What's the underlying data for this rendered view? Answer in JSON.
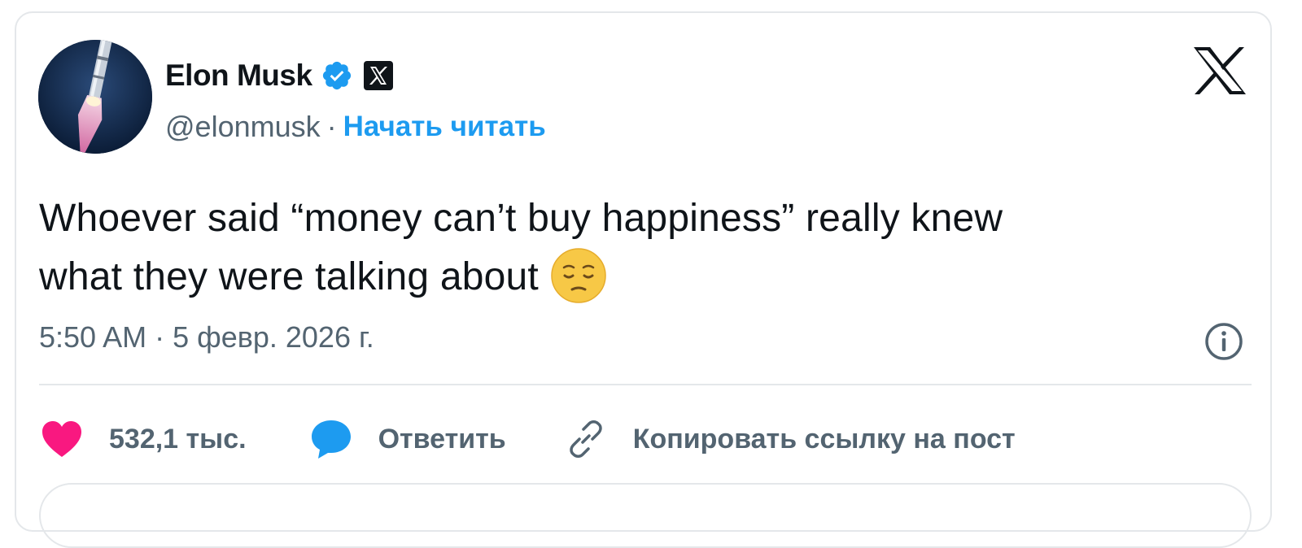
{
  "post": {
    "author": {
      "name": "Elon Musk",
      "handle": "@elonmusk",
      "separator": "·",
      "follow_label": "Начать читать",
      "verified_color": "#1d9bf0"
    },
    "text_line1": "Whoever said “money can’t buy happiness” really knew",
    "text_line2": "what they were talking about",
    "emoji": "pensive-face-emoji",
    "timestamp": "5:50 AM · 5 февр. 2026 г.",
    "actions": {
      "likes_label": "532,1 тыс.",
      "reply_label": "Ответить",
      "copy_link_label": "Копировать ссылку на пост"
    }
  },
  "icons": {
    "verified": "verified-badge-icon",
    "affiliate": "x-affiliate-badge-icon",
    "logo": "x-logo-icon",
    "info": "info-icon",
    "like": "heart-icon",
    "reply": "speech-bubble-icon",
    "link": "link-icon"
  },
  "colors": {
    "accent": "#1d9bf0",
    "like": "#f91880",
    "text": "#0f1419",
    "secondary": "#536471"
  }
}
